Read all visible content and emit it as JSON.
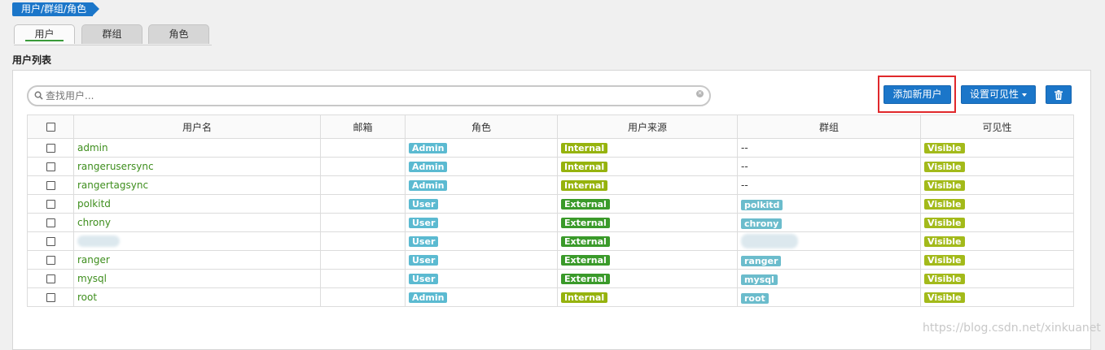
{
  "breadcrumb": "用户/群组/角色",
  "tabs": [
    "用户",
    "群组",
    "角色"
  ],
  "section_title": "用户列表",
  "search": {
    "placeholder": "查找用户..."
  },
  "buttons": {
    "add_user": "添加新用户",
    "set_visibility": "设置可见性"
  },
  "columns": [
    "用户名",
    "邮箱",
    "角色",
    "用户来源",
    "群组",
    "可见性"
  ],
  "rows": [
    {
      "name": "admin",
      "email": "",
      "role": "Admin",
      "source": "Internal",
      "group": "--",
      "visibility": "Visible"
    },
    {
      "name": "rangerusersync",
      "email": "",
      "role": "Admin",
      "source": "Internal",
      "group": "--",
      "visibility": "Visible"
    },
    {
      "name": "rangertagsync",
      "email": "",
      "role": "Admin",
      "source": "Internal",
      "group": "--",
      "visibility": "Visible"
    },
    {
      "name": "polkitd",
      "email": "",
      "role": "User",
      "source": "External",
      "group": "polkitd",
      "visibility": "Visible"
    },
    {
      "name": "chrony",
      "email": "",
      "role": "User",
      "source": "External",
      "group": "chrony",
      "visibility": "Visible"
    },
    {
      "name": "",
      "email": "",
      "role": "User",
      "source": "External",
      "group": "",
      "visibility": "Visible",
      "blurred": true
    },
    {
      "name": "ranger",
      "email": "",
      "role": "User",
      "source": "External",
      "group": "ranger",
      "visibility": "Visible"
    },
    {
      "name": "mysql",
      "email": "",
      "role": "User",
      "source": "External",
      "group": "mysql",
      "visibility": "Visible"
    },
    {
      "name": "root",
      "email": "",
      "role": "Admin",
      "source": "Internal",
      "group": "root",
      "visibility": "Visible"
    }
  ],
  "watermark": "https://blog.csdn.net/xinkuanet"
}
